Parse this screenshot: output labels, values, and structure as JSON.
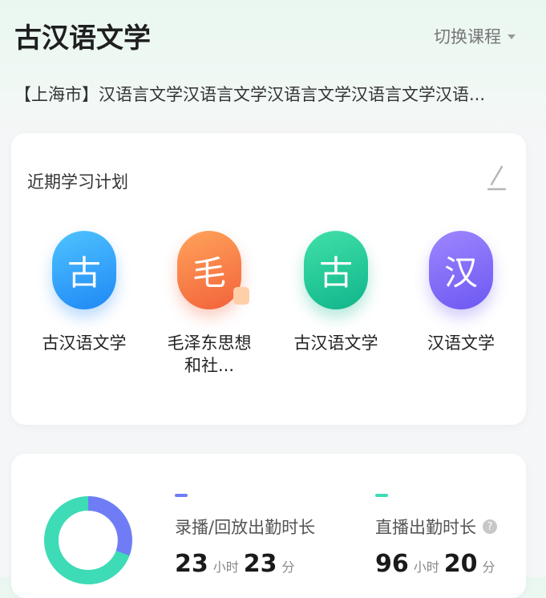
{
  "header": {
    "title": "古汉语文学",
    "switch_label": "切换课程",
    "subtitle": "【上海市】汉语言文学汉语言文学汉语言文学汉语言文学汉语..."
  },
  "plan": {
    "title": "近期学习计划",
    "courses": [
      {
        "char": "古",
        "name": "古汉语文学",
        "color": "#2196f3"
      },
      {
        "char": "毛",
        "name_line1": "毛泽东思想",
        "name_line2": "和社...",
        "color": "#f4733f"
      },
      {
        "char": "古",
        "name": "古汉语文学",
        "color": "#17c08f"
      },
      {
        "char": "汉",
        "name": "汉语文学",
        "color": "#7561f3"
      }
    ]
  },
  "stats": {
    "recorded": {
      "label": "录播/回放出勤时长",
      "hours": "23",
      "hour_unit": "小时",
      "minutes": "23",
      "minute_unit": "分",
      "color": "#6f7cf6"
    },
    "live": {
      "label": "直播出勤时长",
      "hours": "96",
      "hour_unit": "小时",
      "minutes": "20",
      "minute_unit": "分",
      "color": "#3ddbb6"
    }
  }
}
